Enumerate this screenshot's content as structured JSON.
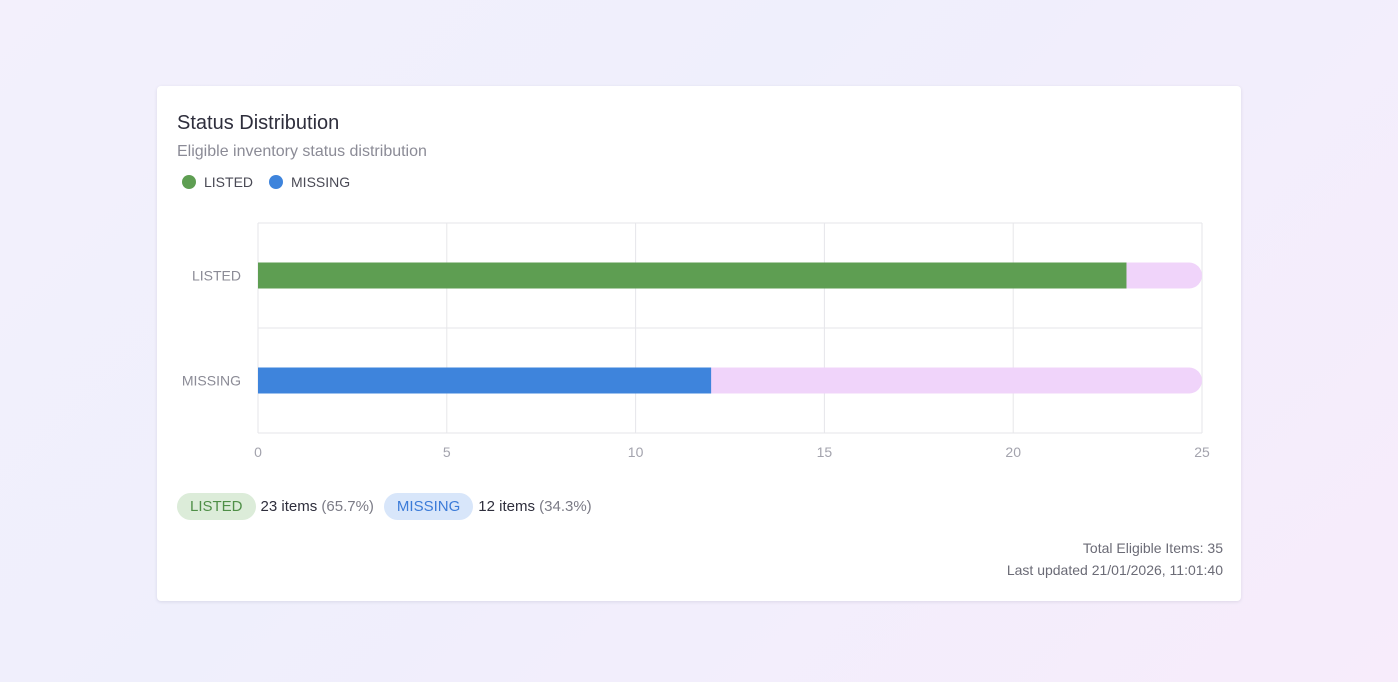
{
  "card": {
    "title": "Status Distribution",
    "subtitle": "Eligible inventory status distribution"
  },
  "legend": [
    {
      "label": "LISTED",
      "color": "#5e9e52"
    },
    {
      "label": "MISSING",
      "color": "#3e84dc"
    }
  ],
  "chart_data": {
    "type": "bar",
    "orientation": "horizontal",
    "categories": [
      "LISTED",
      "MISSING"
    ],
    "values": [
      23,
      12
    ],
    "colors": [
      "#5e9e52",
      "#3e84dc"
    ],
    "track_color": "#f0d4fa",
    "xlim": [
      0,
      25
    ],
    "xticks": [
      0,
      5,
      10,
      15,
      20,
      25
    ],
    "grid": true,
    "legend_position": "top-left"
  },
  "summary": [
    {
      "label": "LISTED",
      "count": "23 items",
      "pct": "(65.7%)"
    },
    {
      "label": "MISSING",
      "count": "12 items",
      "pct": "(34.3%)"
    }
  ],
  "footer": {
    "total": "Total Eligible Items: 35",
    "updated": "Last updated 21/01/2026, 11:01:40"
  }
}
